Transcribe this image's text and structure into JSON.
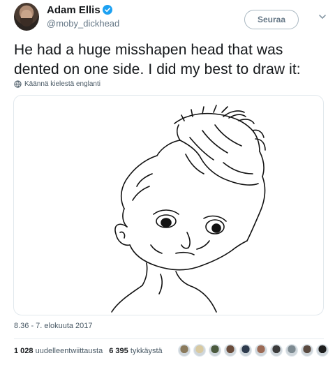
{
  "author": {
    "name": "Adam Ellis",
    "handle": "@moby_dickhead",
    "verified": true,
    "avatar_icon": "profile-photo"
  },
  "follow_button": {
    "label": "Seuraa"
  },
  "menu_icon": "chevron-down-icon",
  "tweet": {
    "text": "He had a huge misshapen head that was dented on one side. I did my best to draw it:",
    "translate_label": "Käännä kielestä englanti",
    "translate_icon": "globe-icon"
  },
  "media": {
    "kind": "line-drawing",
    "subject": "child-with-misshapen-head"
  },
  "timestamp": "8.36 - 7. elokuuta 2017",
  "stats": {
    "retweets_count": "1 028",
    "retweets_label": "uudelleentwiittausta",
    "likes_count": "6 395",
    "likes_label": "tykkäystä"
  },
  "likers": [
    {
      "icon": "liker-avatar",
      "color": "#8a7a5c"
    },
    {
      "icon": "liker-avatar",
      "color": "#d8c9a0"
    },
    {
      "icon": "liker-avatar",
      "color": "#4b5a3e"
    },
    {
      "icon": "liker-avatar",
      "color": "#6a4c3b"
    },
    {
      "icon": "liker-avatar",
      "color": "#2e3b4d"
    },
    {
      "icon": "liker-avatar",
      "color": "#9c6a55"
    },
    {
      "icon": "liker-avatar",
      "color": "#3b3b3b"
    },
    {
      "icon": "liker-avatar",
      "color": "#7d8a91"
    },
    {
      "icon": "liker-avatar",
      "color": "#5a4a40"
    },
    {
      "icon": "liker-avatar",
      "color": "#1e1e1e"
    }
  ],
  "colors": {
    "accent": "#1da1f2",
    "text": "#14171a",
    "muted": "#657786"
  }
}
